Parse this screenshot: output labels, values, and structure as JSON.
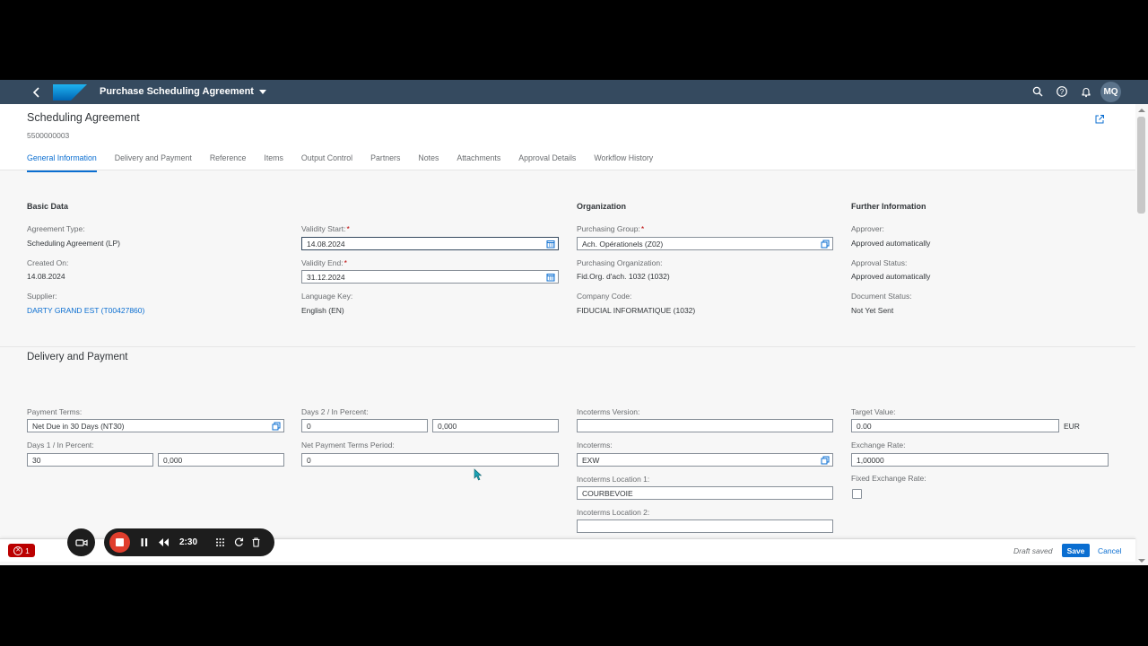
{
  "shell": {
    "title": "Purchase Scheduling Agreement",
    "logo": "SAP",
    "avatar": "MQ"
  },
  "header": {
    "title": "Scheduling Agreement",
    "number": "5500000003"
  },
  "tabs": [
    "General Information",
    "Delivery and Payment",
    "Reference",
    "Items",
    "Output Control",
    "Partners",
    "Notes",
    "Attachments",
    "Approval Details",
    "Workflow History"
  ],
  "basic_data": {
    "title": "Basic Data",
    "agreement_type_label": "Agreement Type:",
    "agreement_type": "Scheduling Agreement (LP)",
    "created_on_label": "Created On:",
    "created_on": "14.08.2024",
    "supplier_label": "Supplier:",
    "supplier": "DARTY GRAND EST (T00427860)",
    "validity_start_label": "Validity Start:",
    "validity_start": "14.08.2024",
    "validity_end_label": "Validity End:",
    "validity_end": "31.12.2024",
    "language_key_label": "Language Key:",
    "language_key": "English (EN)"
  },
  "organization": {
    "title": "Organization",
    "purchasing_group_label": "Purchasing Group:",
    "purchasing_group": "Ach. Opérationels (Z02)",
    "purchasing_org_label": "Purchasing Organization:",
    "purchasing_org": "Fid.Org. d'ach. 1032 (1032)",
    "company_code_label": "Company Code:",
    "company_code": "FIDUCIAL INFORMATIQUE (1032)"
  },
  "further_info": {
    "title": "Further Information",
    "approver_label": "Approver:",
    "approver": "Approved automatically",
    "approval_status_label": "Approval Status:",
    "approval_status": "Approved automatically",
    "document_status_label": "Document Status:",
    "document_status": "Not Yet Sent"
  },
  "delivery_payment": {
    "title": "Delivery and Payment",
    "payment_terms_label": "Payment Terms:",
    "payment_terms": "Net Due in 30 Days (NT30)",
    "days1_label": "Days 1 / In Percent:",
    "days1": "30",
    "days1_pct": "0,000",
    "days2_label": "Days 2 / In Percent:",
    "days2": "0",
    "days2_pct": "0,000",
    "net_period_label": "Net Payment Terms Period:",
    "net_period": "0",
    "incoterms_version_label": "Incoterms Version:",
    "incoterms_version": "",
    "incoterms_label": "Incoterms:",
    "incoterms": "EXW",
    "incoterms_loc1_label": "Incoterms Location 1:",
    "incoterms_loc1": "COURBEVOIE",
    "incoterms_loc2_label": "Incoterms Location 2:",
    "incoterms_loc2": "",
    "target_value_label": "Target Value:",
    "target_value": "0.00",
    "target_currency": "EUR",
    "exchange_rate_label": "Exchange Rate:",
    "exchange_rate": " 1,00000",
    "fixed_rate_label": "Fixed Exchange Rate:",
    "fixed_rate_checked": false
  },
  "footer": {
    "error_count": "1",
    "draft_status": "Draft saved",
    "save": "Save",
    "cancel": "Cancel"
  },
  "recorder": {
    "time": "2:30"
  },
  "colors": {
    "shell": "#354a5f",
    "accent": "#0a6ed1",
    "error": "#bb0000"
  }
}
